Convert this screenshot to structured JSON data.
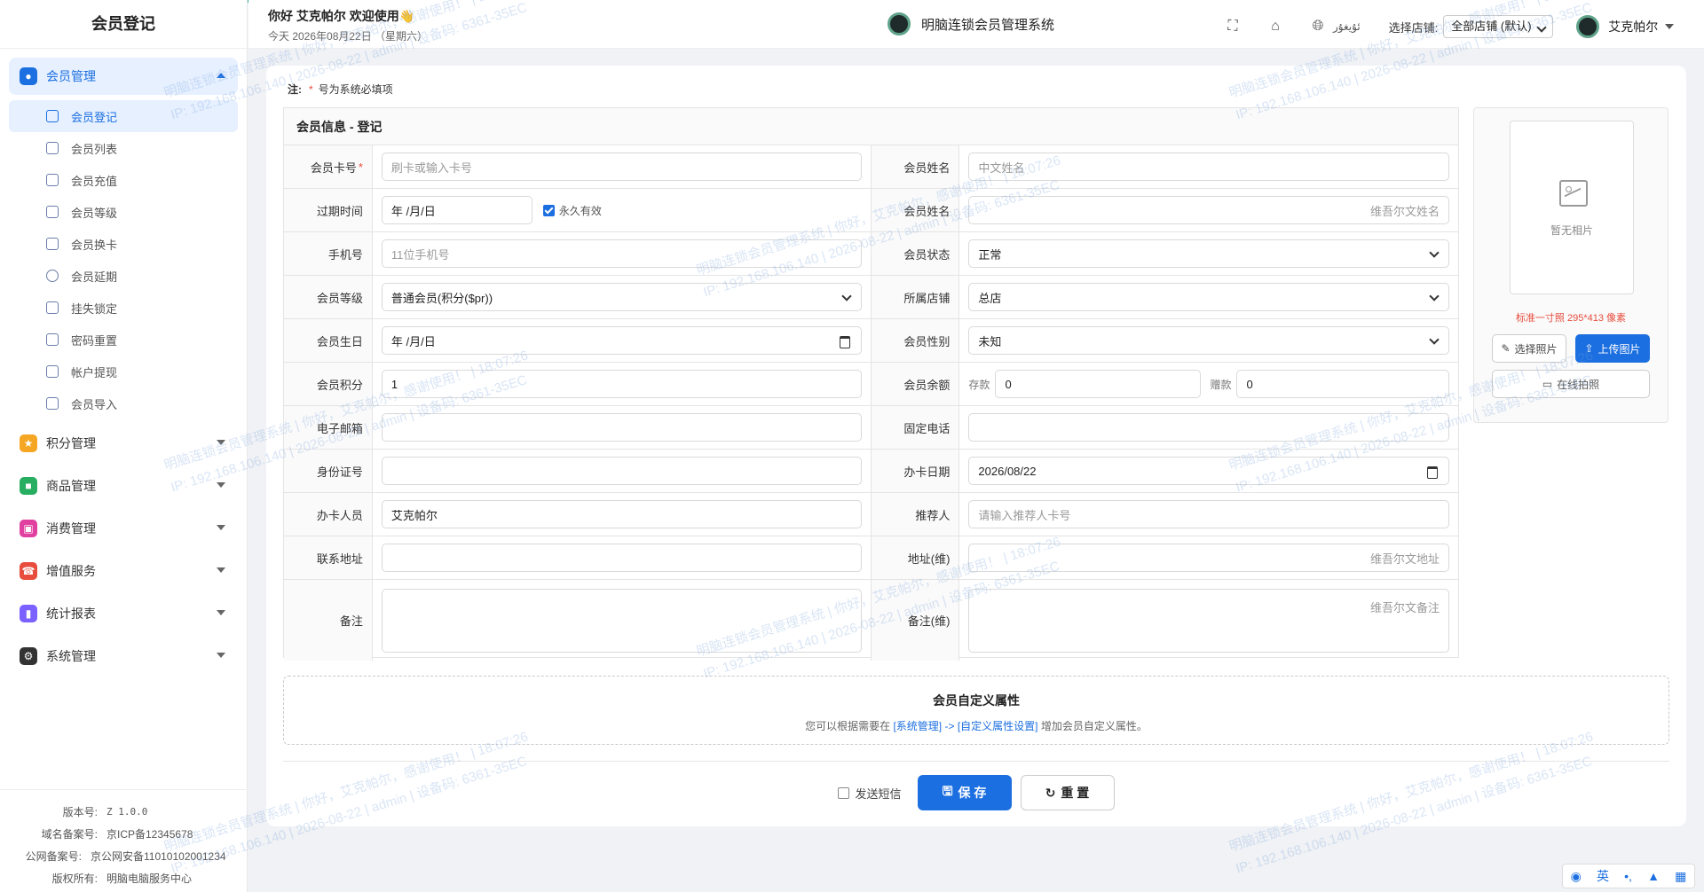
{
  "sidebar": {
    "title": "会员登记",
    "groups": [
      {
        "label": "会员管理",
        "color": "#1c6fe0",
        "icon": "users-icon"
      },
      {
        "label": "积分管理",
        "color": "#f5a623",
        "icon": "star-icon"
      },
      {
        "label": "商品管理",
        "color": "#27ae60",
        "icon": "box-icon"
      },
      {
        "label": "消费管理",
        "color": "#e040a0",
        "icon": "cart-icon"
      },
      {
        "label": "增值服务",
        "color": "#e74c3c",
        "icon": "phone-icon"
      },
      {
        "label": "统计报表",
        "color": "#7b61ff",
        "icon": "chart-icon"
      },
      {
        "label": "系统管理",
        "color": "#333333",
        "icon": "gear-icon"
      }
    ],
    "sub_items": [
      "会员登记",
      "会员列表",
      "会员充值",
      "会员等级",
      "会员换卡",
      "会员延期",
      "挂失锁定",
      "密码重置",
      "帐户提现",
      "会员导入"
    ],
    "footer": {
      "version_label": "版本号:",
      "version": "Z 1.0.0",
      "icp_label": "域名备案号:",
      "icp": "京ICP备12345678",
      "police_label": "公网备案号:",
      "police": "京公网安备11010102001234",
      "copyright_label": "版权所有:",
      "copyright": "明脑电脑服务中心"
    }
  },
  "header": {
    "greeting": "你好 艾克帕尔 欢迎使用👋",
    "date": "今天 2026年08月22日 （星期六）",
    "brand": "明脑连锁会员管理系统",
    "lang": "ئۇيغۇر",
    "store_label": "选择店铺:",
    "store_value": "全部店铺 (默认)",
    "user": "艾克帕尔"
  },
  "note": {
    "prefix": "注:",
    "star": "*",
    "text": "号为系统必填项"
  },
  "form": {
    "title": "会员信息 - 登记",
    "card_no": {
      "label": "会员卡号",
      "req": "*",
      "placeholder": "刷卡或输入卡号"
    },
    "name_cn": {
      "label": "会员姓名",
      "placeholder": "中文姓名"
    },
    "expire": {
      "label": "过期时间",
      "value": "年 /月/日",
      "check_label": "永久有效"
    },
    "name_ug": {
      "label": "会员姓名",
      "placeholder": "维吾尔文姓名"
    },
    "phone": {
      "label": "手机号",
      "placeholder": "11位手机号"
    },
    "status": {
      "label": "会员状态",
      "value": "正常"
    },
    "level": {
      "label": "会员等级",
      "value": "普通会员(积分($pr))"
    },
    "store": {
      "label": "所属店铺",
      "value": "总店"
    },
    "birthday": {
      "label": "会员生日",
      "value": "年 /月/日"
    },
    "gender": {
      "label": "会员性别",
      "value": "未知"
    },
    "points": {
      "label": "会员积分",
      "value": "1"
    },
    "balance": {
      "label": "会员余额",
      "deposit_label": "存款",
      "deposit": "0",
      "gift_label": "赠款",
      "gift": "0"
    },
    "email": {
      "label": "电子邮箱",
      "value": ""
    },
    "landline": {
      "label": "固定电话",
      "value": ""
    },
    "id_card": {
      "label": "身份证号",
      "value": ""
    },
    "open_date": {
      "label": "办卡日期",
      "value": "2026/08/22"
    },
    "operator": {
      "label": "办卡人员",
      "value": "艾克帕尔"
    },
    "referrer": {
      "label": "推荐人",
      "placeholder": "请输入推荐人卡号"
    },
    "address": {
      "label": "联系地址",
      "value": ""
    },
    "address_ug": {
      "label": "地址(维)",
      "placeholder": "维吾尔文地址"
    },
    "remark": {
      "label": "备注",
      "value": ""
    },
    "remark_ug": {
      "label": "备注(维)",
      "placeholder": "维吾尔文备注"
    }
  },
  "photo": {
    "empty": "暂无相片",
    "spec": "标准一寸照 295*413 像素",
    "choose": "选择照片",
    "upload": "上传图片",
    "camera": "在线拍照"
  },
  "custom": {
    "title": "会员自定义属性",
    "desc_pre": "您可以根据需要在",
    "link1": "[系统管理]",
    "arrow": "->",
    "link2": "[自定义属性设置]",
    "desc_post": "增加会员自定义属性。"
  },
  "actions": {
    "sms": "发送短信",
    "save": "保 存",
    "reset": "重 置"
  },
  "watermark": {
    "line1": "明脑连锁会员管理系统 | 你好，艾克帕尔，感谢使用！ | 18:07:26",
    "line2": "IP: 192.168.106.140 | 2026-08-22 | admin | 设备码: 6361-35EC"
  },
  "ime": {
    "lang": "英"
  },
  "colors": {
    "accent": "#1c6fe0",
    "required": "#e74c3c"
  }
}
